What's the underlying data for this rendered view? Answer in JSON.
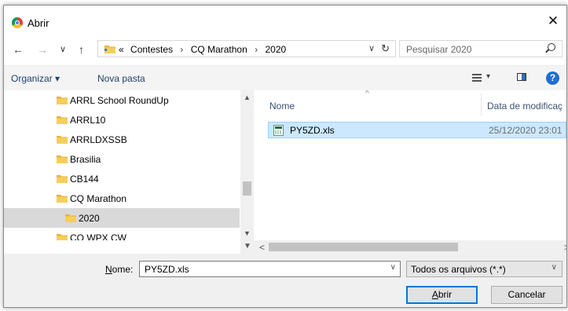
{
  "window": {
    "title": "Abrir",
    "close": "✕",
    "app_icon": "chrome-icon"
  },
  "nav": {
    "back": "←",
    "forward": "→",
    "recent": "∨",
    "up": "↑",
    "breadcrumb": [
      "«",
      "Contestes",
      "CQ Marathon",
      "2020"
    ],
    "breadcrumb_sep": "›",
    "address_dropdown": "∨",
    "refresh": "↻"
  },
  "search": {
    "placeholder": "Pesquisar 2020"
  },
  "toolbar": {
    "organize": "Organizar ▾",
    "new_folder": "Nova pasta",
    "view_dropdown": "▾",
    "help": "?"
  },
  "tree": {
    "items": [
      {
        "label": "ARRL School RoundUp",
        "level": 1,
        "selected": false
      },
      {
        "label": "ARRL10",
        "level": 1,
        "selected": false
      },
      {
        "label": "ARRLDXSSB",
        "level": 1,
        "selected": false
      },
      {
        "label": "Brasilia",
        "level": 1,
        "selected": false
      },
      {
        "label": "CB144",
        "level": 1,
        "selected": false
      },
      {
        "label": "CQ Marathon",
        "level": 1,
        "selected": false
      },
      {
        "label": "2020",
        "level": 2,
        "selected": true
      },
      {
        "label": "CQ WPX CW",
        "level": 1,
        "selected": false
      }
    ],
    "scroll_up": "▲",
    "scroll_down": "▼"
  },
  "files": {
    "columns": {
      "name": "Nome",
      "date": "Data de modificaç",
      "sort_glyph": "^"
    },
    "rows": [
      {
        "name": "PY5ZD.xls",
        "date": "25/12/2020 23:01",
        "selected": true
      }
    ],
    "scroll_left": "<",
    "scroll_right": ">"
  },
  "bottom": {
    "name_label_prefix": "N",
    "name_label_rest": "ome:",
    "filename": "PY5ZD.xls",
    "filename_dropdown": "∨",
    "file_type": "Todos os arquivos (*.*)",
    "file_type_dropdown": "∨",
    "open_first": "A",
    "open_rest": "brir",
    "cancel": "Cancelar"
  },
  "colors": {
    "folder": "#e8b33a",
    "selection": "#cce8ff",
    "tree_selection": "#d9d9d9",
    "accent": "#0078d7"
  }
}
